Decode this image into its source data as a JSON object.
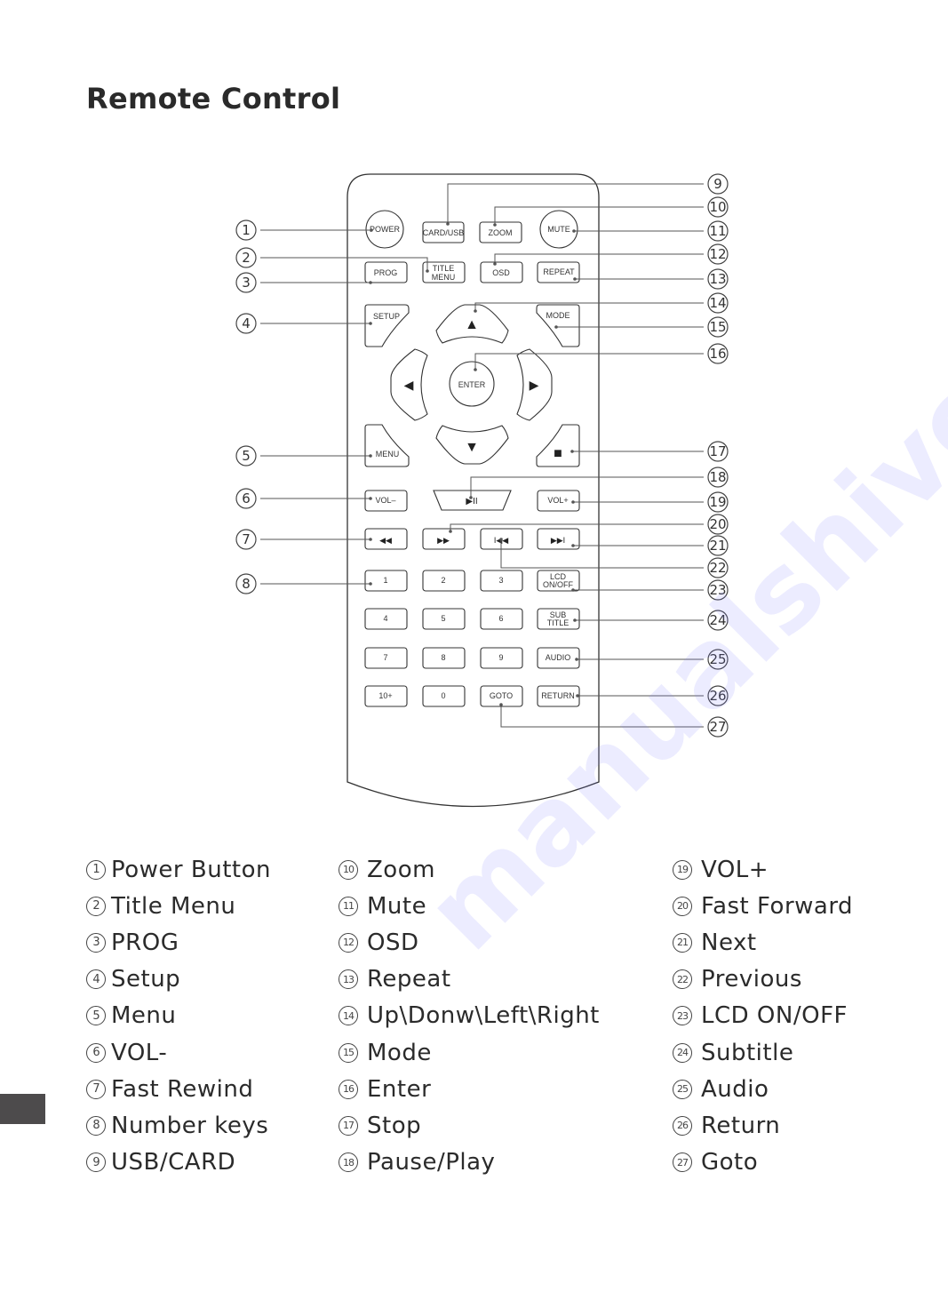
{
  "page": {
    "title": "Remote Control",
    "watermark": "manualshive.com"
  },
  "remote": {
    "buttons": {
      "power": "POWER",
      "card_usb": "CARD/USB",
      "zoom": "ZOOM",
      "mute": "MUTE",
      "prog": "PROG",
      "title_menu_1": "TITLE",
      "title_menu_2": "MENU",
      "osd": "OSD",
      "repeat": "REPEAT",
      "setup": "SETUP",
      "mode": "MODE",
      "enter": "ENTER",
      "menu": "MENU",
      "stop": "■",
      "up": "▲",
      "down": "▼",
      "left": "◀",
      "right": "▶",
      "vol_minus": "VOL–",
      "play_pause": "▶II",
      "vol_plus": "VOL+",
      "rewind": "◀◀",
      "fast_forward": "▶▶",
      "previous": "I◀◀",
      "next": "▶▶I",
      "n1": "1",
      "n2": "2",
      "n3": "3",
      "lcd_1": "LCD",
      "lcd_2": "ON/OFF",
      "n4": "4",
      "n5": "5",
      "n6": "6",
      "sub_1": "SUB",
      "sub_2": "TITLE",
      "n7": "7",
      "n8": "8",
      "n9": "9",
      "audio": "AUDIO",
      "n10plus": "10+",
      "n0": "0",
      "goto": "GOTO",
      "return": "RETURN"
    }
  },
  "callouts": [
    "1",
    "2",
    "3",
    "4",
    "5",
    "6",
    "7",
    "8",
    "9",
    "10",
    "11",
    "12",
    "13",
    "14",
    "15",
    "16",
    "17",
    "18",
    "19",
    "20",
    "21",
    "22",
    "23",
    "24",
    "25",
    "26",
    "27"
  ],
  "legend": {
    "col1": [
      {
        "num": "1",
        "label": "Power Button"
      },
      {
        "num": "2",
        "label": "Title Menu"
      },
      {
        "num": "3",
        "label": "PROG"
      },
      {
        "num": "4",
        "label": "Setup"
      },
      {
        "num": "5",
        "label": "Menu"
      },
      {
        "num": "6",
        "label": "VOL-"
      },
      {
        "num": "7",
        "label": "Fast Rewind"
      },
      {
        "num": "8",
        "label": "Number keys"
      },
      {
        "num": "9",
        "label": "USB/CARD"
      }
    ],
    "col2": [
      {
        "num": "10",
        "label": "Zoom"
      },
      {
        "num": "11",
        "label": "Mute"
      },
      {
        "num": "12",
        "label": "OSD"
      },
      {
        "num": "13",
        "label": "Repeat"
      },
      {
        "num": "14",
        "label": "Up\\Donw\\Left\\Right"
      },
      {
        "num": "15",
        "label": "Mode"
      },
      {
        "num": "16",
        "label": "Enter"
      },
      {
        "num": "17",
        "label": "Stop"
      },
      {
        "num": "18",
        "label": "Pause/Play"
      }
    ],
    "col3": [
      {
        "num": "19",
        "label": "VOL+"
      },
      {
        "num": "20",
        "label": "Fast Forward"
      },
      {
        "num": "21",
        "label": "Next"
      },
      {
        "num": "22",
        "label": "Previous"
      },
      {
        "num": "23",
        "label": "LCD ON/OFF"
      },
      {
        "num": "24",
        "label": "Subtitle"
      },
      {
        "num": "25",
        "label": "Audio"
      },
      {
        "num": "26",
        "label": "Return"
      },
      {
        "num": "27",
        "label": "Goto"
      }
    ]
  }
}
